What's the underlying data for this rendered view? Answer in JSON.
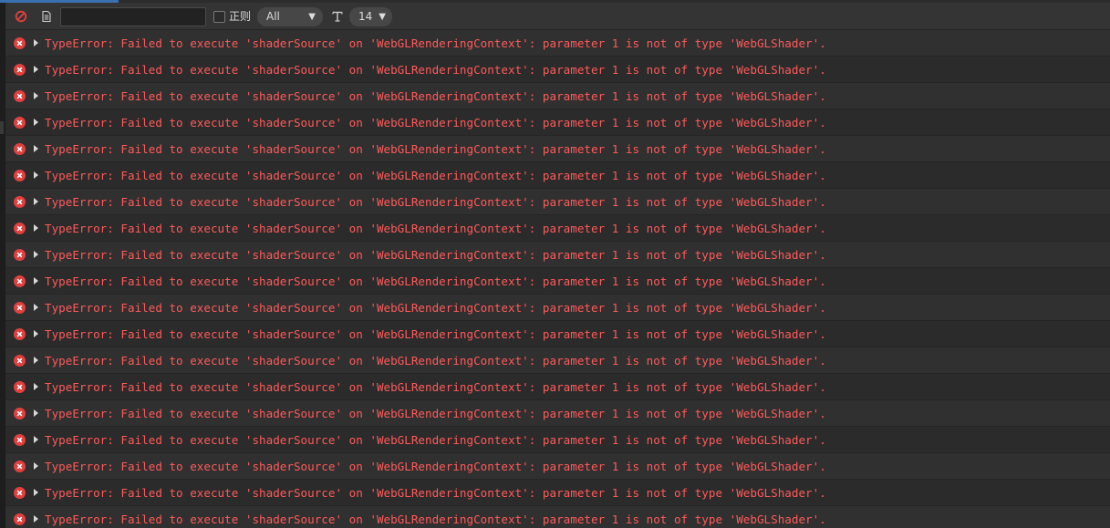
{
  "toolbar": {
    "filter_value": "",
    "regex_label": "正则",
    "level_value": "All",
    "font_size_value": "14"
  },
  "icons": {
    "clear": "no-entry-icon",
    "log": "document-icon",
    "font": "text-size-icon",
    "error": "error-circle-icon",
    "expand": "triangle-right-icon"
  },
  "colors": {
    "error_text": "#ff5a5a",
    "error_icon": "#e0403e",
    "accent": "#3a6fb0"
  },
  "logs": [
    {
      "text": "TypeError: Failed to execute 'shaderSource' on 'WebGLRenderingContext': parameter 1 is not of type 'WebGLShader'."
    },
    {
      "text": "TypeError: Failed to execute 'shaderSource' on 'WebGLRenderingContext': parameter 1 is not of type 'WebGLShader'."
    },
    {
      "text": "TypeError: Failed to execute 'shaderSource' on 'WebGLRenderingContext': parameter 1 is not of type 'WebGLShader'."
    },
    {
      "text": "TypeError: Failed to execute 'shaderSource' on 'WebGLRenderingContext': parameter 1 is not of type 'WebGLShader'."
    },
    {
      "text": "TypeError: Failed to execute 'shaderSource' on 'WebGLRenderingContext': parameter 1 is not of type 'WebGLShader'."
    },
    {
      "text": "TypeError: Failed to execute 'shaderSource' on 'WebGLRenderingContext': parameter 1 is not of type 'WebGLShader'."
    },
    {
      "text": "TypeError: Failed to execute 'shaderSource' on 'WebGLRenderingContext': parameter 1 is not of type 'WebGLShader'."
    },
    {
      "text": "TypeError: Failed to execute 'shaderSource' on 'WebGLRenderingContext': parameter 1 is not of type 'WebGLShader'."
    },
    {
      "text": "TypeError: Failed to execute 'shaderSource' on 'WebGLRenderingContext': parameter 1 is not of type 'WebGLShader'."
    },
    {
      "text": "TypeError: Failed to execute 'shaderSource' on 'WebGLRenderingContext': parameter 1 is not of type 'WebGLShader'."
    },
    {
      "text": "TypeError: Failed to execute 'shaderSource' on 'WebGLRenderingContext': parameter 1 is not of type 'WebGLShader'."
    },
    {
      "text": "TypeError: Failed to execute 'shaderSource' on 'WebGLRenderingContext': parameter 1 is not of type 'WebGLShader'."
    },
    {
      "text": "TypeError: Failed to execute 'shaderSource' on 'WebGLRenderingContext': parameter 1 is not of type 'WebGLShader'."
    },
    {
      "text": "TypeError: Failed to execute 'shaderSource' on 'WebGLRenderingContext': parameter 1 is not of type 'WebGLShader'."
    },
    {
      "text": "TypeError: Failed to execute 'shaderSource' on 'WebGLRenderingContext': parameter 1 is not of type 'WebGLShader'."
    },
    {
      "text": "TypeError: Failed to execute 'shaderSource' on 'WebGLRenderingContext': parameter 1 is not of type 'WebGLShader'."
    },
    {
      "text": "TypeError: Failed to execute 'shaderSource' on 'WebGLRenderingContext': parameter 1 is not of type 'WebGLShader'."
    },
    {
      "text": "TypeError: Failed to execute 'shaderSource' on 'WebGLRenderingContext': parameter 1 is not of type 'WebGLShader'."
    },
    {
      "text": "TypeError: Failed to execute 'shaderSource' on 'WebGLRenderingContext': parameter 1 is not of type 'WebGLShader'."
    }
  ]
}
